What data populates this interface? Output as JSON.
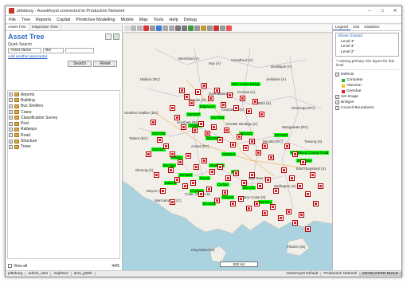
{
  "window": {
    "title": "pittsburg - AssetAsyst connected to Production Network"
  },
  "menu": [
    "File",
    "Tree",
    "Reports",
    "Capital",
    "Predictive Modelling",
    "Mobile",
    "Map",
    "Tools",
    "Help",
    "Debug"
  ],
  "left_panel": {
    "tabs": [
      "Asset Tree",
      "Inspection Tree"
    ],
    "title": "Asset Tree",
    "quick_search_label": "Quick Search",
    "field_select": "Asset Name",
    "operator_select": "like",
    "add_parameter_link": "Add another parameter",
    "search_button": "Search",
    "reset_button": "Reset",
    "tree_items": [
      "Airports",
      "Building",
      "Bus Shelters",
      "Crane",
      "Classification Survey",
      "Pool",
      "Railways",
      "Road",
      "Structure",
      "Trees"
    ],
    "view_all_label": "View all",
    "count": "44/5"
  },
  "map": {
    "place_labels": [
      "Bremhold (A)",
      "Hay (A)",
      "Carrathool (A)",
      "Deniliquin (A)",
      "Jerilderie (A)",
      "Mildura (RC)",
      "Corowa (A)",
      "Buloke (S)",
      "Gannawarra (S)",
      "Campaspe (S)",
      "Moira (S)",
      "Wodonga (RC)",
      "Southern Mallee (DC)",
      "Horsham (RC)",
      "Greater Bendigo (C)",
      "Wangaratta (RC)",
      "Tatiara (DC)",
      "Ararat (RC)",
      "Benalla (RC)",
      "Towong (S)",
      "East Gippsland (S)",
      "Wellington (S)",
      "Baw Baw (S)",
      "Colac Otway (S)",
      "Bass Coast (S)",
      "King Island (M)",
      "Flinders (M)",
      "Glenelg (S)",
      "Moyne (S)",
      "Warrnambool (C)"
    ],
    "green_labels": [
      "SW1 Green Badge",
      "Edgeware",
      "SW4087",
      "SW7006",
      "SW5007",
      "SW7008",
      "SW1021",
      "SW1025",
      "SW2098",
      "SW3127",
      "Wildlife",
      "SW9024",
      "Bendigo",
      "Hawthorn",
      "Kew",
      "SW1800",
      "Fauna",
      "Ballarat",
      "Carlton",
      "DW Crs",
      "Geelong",
      "Clayton",
      "Monash",
      "SW Drm",
      "Heidelberg Change Road",
      "SW Drain"
    ],
    "scale_label": "500 km"
  },
  "right_panel": {
    "tabs": [
      "Legend",
      "GIS",
      "Statistics"
    ],
    "levels": [
      "Above Ground",
      "Level 4\"",
      "Level 3\"",
      "Level 2\""
    ],
    "note": "* missing primary GIS layers for this level",
    "layers": [
      {
        "label": "Defects",
        "color": ""
      },
      {
        "label": "Complete",
        "color": "#2eaa32"
      },
      {
        "label": "Attention",
        "color": "#f6c70f"
      },
      {
        "label": "Overdue",
        "color": "#e41f2b"
      },
      {
        "label": "Set Image",
        "color": ""
      },
      {
        "label": "Bridges",
        "color": ""
      },
      {
        "label": "Council Boundaries",
        "color": ""
      }
    ]
  },
  "status": {
    "user_icon_label": "pittsburg",
    "user": "admin_user",
    "server": "\\sql2012",
    "db": "ams_pittsh",
    "network_left": "AssetAsyst Default",
    "network": "Production Network",
    "build": "DEVELOPER BUILD"
  },
  "colors": {
    "accent": "#2f6ec4",
    "overdue": "#e41f2b",
    "label_bg": "#00ff00",
    "water": "#aad3df",
    "land": "#f2efe9"
  }
}
